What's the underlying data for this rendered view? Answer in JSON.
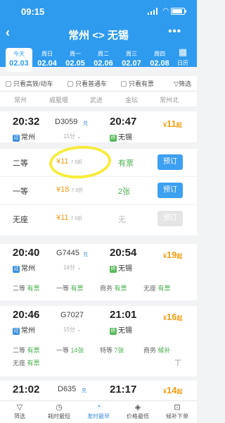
{
  "status": {
    "time": "09:15"
  },
  "titlebar": {
    "back_icon": "chevron-left-icon",
    "route": "常州 <> 无锡",
    "more_icon": "ellipsis-icon"
  },
  "dates": [
    {
      "weekday": "今天",
      "date": "02.03",
      "active": true
    },
    {
      "weekday": "周日",
      "date": "02.04"
    },
    {
      "weekday": "周一",
      "date": "02.05"
    },
    {
      "weekday": "周二",
      "date": "02.06"
    },
    {
      "weekday": "周三",
      "date": "02.07"
    },
    {
      "weekday": "周四",
      "date": "02.08"
    }
  ],
  "calendar_label": "日历",
  "filters": {
    "high_speed": "只看高铁/动车",
    "normal": "只看普通车",
    "available": "只看有票",
    "filter_link": "筛选"
  },
  "columns": [
    "常州",
    "戚墅堰",
    "武进",
    "金坛",
    "常州北"
  ],
  "trains": [
    {
      "dep_time": "20:32",
      "dep_station": "常州",
      "number": "D3059",
      "fx": "兑",
      "duration": "15分",
      "arr_time": "20:47",
      "arr_station": "无锡",
      "price": "11",
      "qi": "起",
      "seats": [
        {
          "name": "二等",
          "price": "¥11",
          "discount": "7.5折",
          "avail": "有票",
          "button": "预订"
        },
        {
          "name": "一等",
          "price": "¥18",
          "discount": "7.5折",
          "avail": "2张",
          "button": "预订"
        },
        {
          "name": "无座",
          "price": "¥11",
          "discount": "7.5折",
          "avail": "无",
          "button": "预订"
        }
      ]
    },
    {
      "dep_time": "20:40",
      "dep_station": "常州",
      "number": "G7445",
      "fx": "兑",
      "duration": "14分",
      "arr_time": "20:54",
      "arr_station": "无锡",
      "price": "19",
      "qi": "起",
      "seat_line": [
        {
          "name": "二等",
          "avail": "有票"
        },
        {
          "name": "一等",
          "avail": "有票"
        },
        {
          "name": "商务",
          "avail": "有票"
        },
        {
          "name": "无座",
          "avail": "有票"
        }
      ]
    },
    {
      "dep_time": "20:46",
      "dep_station": "常州",
      "number": "G7027",
      "duration": "15分",
      "arr_time": "21:01",
      "arr_station": "无锡",
      "price": "16",
      "qi": "起",
      "seat_line": [
        {
          "name": "二等",
          "avail": "有票"
        },
        {
          "name": "一等",
          "avail": "14张"
        },
        {
          "name": "特等",
          "avail": "7张"
        },
        {
          "name": "商务",
          "avail": "候补"
        }
      ],
      "seat_line2": {
        "name": "无座",
        "avail": "有票"
      }
    },
    {
      "dep_time": "21:02",
      "number": "D635",
      "fx": "兑",
      "arr_time": "21:17",
      "price": "14",
      "qi": "起"
    }
  ],
  "bottom_nav": [
    {
      "label": "筛选",
      "icon": "filter-icon"
    },
    {
      "label": "耗时最短",
      "icon": "clock-icon"
    },
    {
      "label": "发时最早",
      "icon": "early-icon",
      "active": true
    },
    {
      "label": "价格最低",
      "icon": "price-tag-icon"
    },
    {
      "label": "候补下单",
      "icon": "cart-icon"
    }
  ],
  "colors": {
    "primary": "#2f9bef",
    "price": "#f39c12",
    "available": "#4caf50",
    "highlight": "#f7ec3d"
  }
}
